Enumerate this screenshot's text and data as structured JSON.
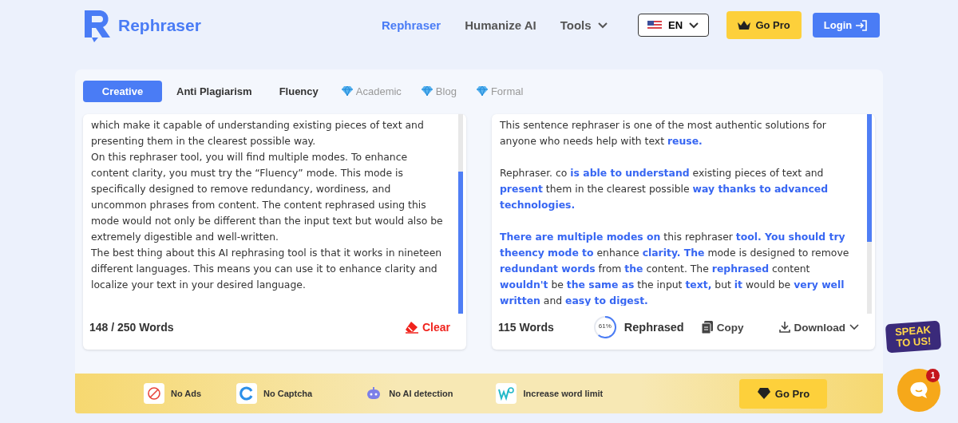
{
  "brand": {
    "name": "Rephraser"
  },
  "nav": [
    {
      "label": "Rephraser",
      "selected": true
    },
    {
      "label": "Humanize AI",
      "selected": false
    },
    {
      "label": "Tools",
      "selected": false,
      "dropdown": true
    }
  ],
  "language": {
    "label": "EN"
  },
  "go_pro": "Go Pro",
  "login": "Login",
  "modes": [
    {
      "label": "Creative",
      "selected": true,
      "premium": false
    },
    {
      "label": "Anti Plagiarism",
      "selected": false,
      "premium": false
    },
    {
      "label": "Fluency",
      "selected": false,
      "premium": false
    },
    {
      "label": "Academic",
      "selected": false,
      "premium": true
    },
    {
      "label": "Blog",
      "selected": false,
      "premium": true
    },
    {
      "label": "Formal",
      "selected": false,
      "premium": true
    }
  ],
  "input": {
    "paragraphs": [
      "which make it capable of understanding existing pieces of text and presenting them in the clearest possible way.",
      "On this rephraser tool, you will find multiple modes. To enhance content clarity, you must try the “Fluency” mode. This mode is specifically designed to remove redundancy, wordiness, and uncommon phrases from content. The content rephrased using this mode would not only be different than the input text but would also be extremely digestible and well-written.",
      "The best thing about this AI rephrasing tool is that it works in nineteen  different languages. This means you can use it to enhance clarity and localize your text in your desired language."
    ],
    "word_count": "148 / 250 Words",
    "clear": "Clear"
  },
  "output": {
    "paragraphs": [
      "This sentence rephraser is one of the most authentic solutions for anyone who needs help with text **reuse.**",
      "Rephraser.  co **is able to understand** existing pieces of text and **present** them in the clearest possible **way thanks to advanced technologies.**",
      "**There are multiple modes on** this rephraser **tool.  You should try theency mode to** enhance **clarity.  The** mode is designed to remove **redundant words** from **the** content.  The **rephrased** content **wouldn't** be **the same as** the input **text,** but **it** would be **very well written** and **easy to digest.**"
    ],
    "word_count": "115 Words",
    "progress": {
      "label": "61%",
      "level": 0.61
    },
    "rephrased": "Rephrased",
    "copy": "Copy",
    "download": "Download"
  },
  "features": [
    "No Ads",
    "No Captcha",
    "No AI detection",
    "Increase word limit"
  ],
  "banner_button": "Go Pro",
  "chat": {
    "speak": "SPEAK TO US!",
    "badge": "1"
  }
}
